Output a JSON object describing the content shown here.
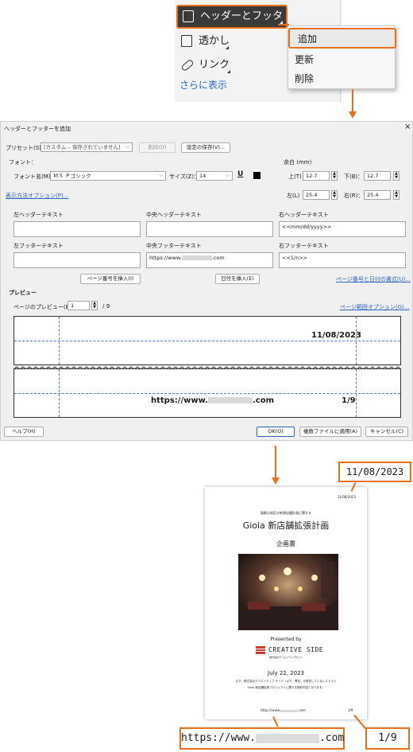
{
  "ribbon": {
    "header_footer_label": "ヘッダーとフッター",
    "watermark_label": "透かし",
    "link_label": "リンク",
    "more_label": "さらに表示"
  },
  "popup": {
    "items": [
      "追加",
      "更新",
      "削除"
    ]
  },
  "dialog": {
    "title": "ヘッダーとフッターを追加",
    "close_symbol": "×",
    "preset_label": "プリセット(S)：",
    "preset_value": "[カスタム – 保存されていません]",
    "delete_button": "削除(D)",
    "save_settings_button": "設定の保存(V)...",
    "font_group_label": "フォント：",
    "font_name_label": "フォント名(M)：",
    "font_name_value": "ＭＳ Ｐゴシック",
    "font_size_label": "サイズ(Z)：",
    "font_size_value": "14",
    "underline_glyph": "U",
    "margin_group_label": "余白 (mm)",
    "margin_top_label": "上(T)",
    "margin_top_value": "12.7",
    "margin_bottom_label": "下(B)：",
    "margin_bottom_value": "12.7",
    "margin_left_label": "左(L)",
    "margin_left_value": "25.4",
    "margin_right_label": "右(R)：",
    "margin_right_value": "25.4",
    "display_options_link": "表示方法オプション(P)...",
    "left_header_label": "左ヘッダーテキスト",
    "left_header_value": "",
    "center_header_label": "中央ヘッダーテキスト",
    "center_header_value": "",
    "right_header_label": "右ヘッダーテキスト",
    "right_header_value": "<<mm/dd/yyyy>>",
    "left_footer_label": "左フッターテキスト",
    "left_footer_value": "",
    "center_footer_label": "中央フッターテキスト",
    "center_footer_value": "https://www.",
    "center_footer_suffix": ".com",
    "right_footer_label": "右フッターテキスト",
    "right_footer_value": "<<1/n>>",
    "insert_page_number_button": "ページ番号を挿入(I)",
    "insert_date_button": "日付を挿入(E)",
    "page_number_date_format_link": "ページ番号と日付の書式(U)...",
    "preview_group_label": "プレビュー",
    "preview_page_label": "ページのプレビュー(E)",
    "preview_page_value": "1",
    "preview_page_total": "/ 9",
    "page_range_options_link": "ページ範囲オプション(G)...",
    "preview_header_date": "11/08/2023",
    "preview_footer_url_prefix": "https://www.",
    "preview_footer_url_suffix": ".com",
    "preview_footer_page": "1/9",
    "help_button": "ヘルプ(H)",
    "ok_button": "OK(O)",
    "apply_multiple_button": "複数ファイルに適用(A)",
    "cancel_button": "キャンセル(C)"
  },
  "document": {
    "header_date": "11/08/2023",
    "subtitle": "副都心地区の新規店舗計画に関する",
    "title": "Gioia 新店舗拡張計画",
    "section": "企画書",
    "presented_by": "Presented by",
    "company": "CREATIVE SIDE",
    "company_sub": "株式会社クリエイティブサイド",
    "date": "July 22, 2023",
    "body_line_1": "以下、株式会社クリエイティブ サイド（以下、弊社）が提供しているレストラン",
    "body_line_2": "Gioia 新店舗拡張プロジェクトに関する契約内容となります。",
    "footer_url_prefix": "https://www.",
    "footer_url_suffix": ".com",
    "footer_page": "1/9"
  },
  "callouts": {
    "date": "11/08/2023",
    "url_prefix": "https://www.",
    "url_suffix": ".com",
    "page": "1/9"
  },
  "colors": {
    "accent_orange": "#e8701a",
    "link_blue": "#2b66c4",
    "guide_blue": "#4a7bd0",
    "ribbon_dark": "#3a3a3a"
  }
}
